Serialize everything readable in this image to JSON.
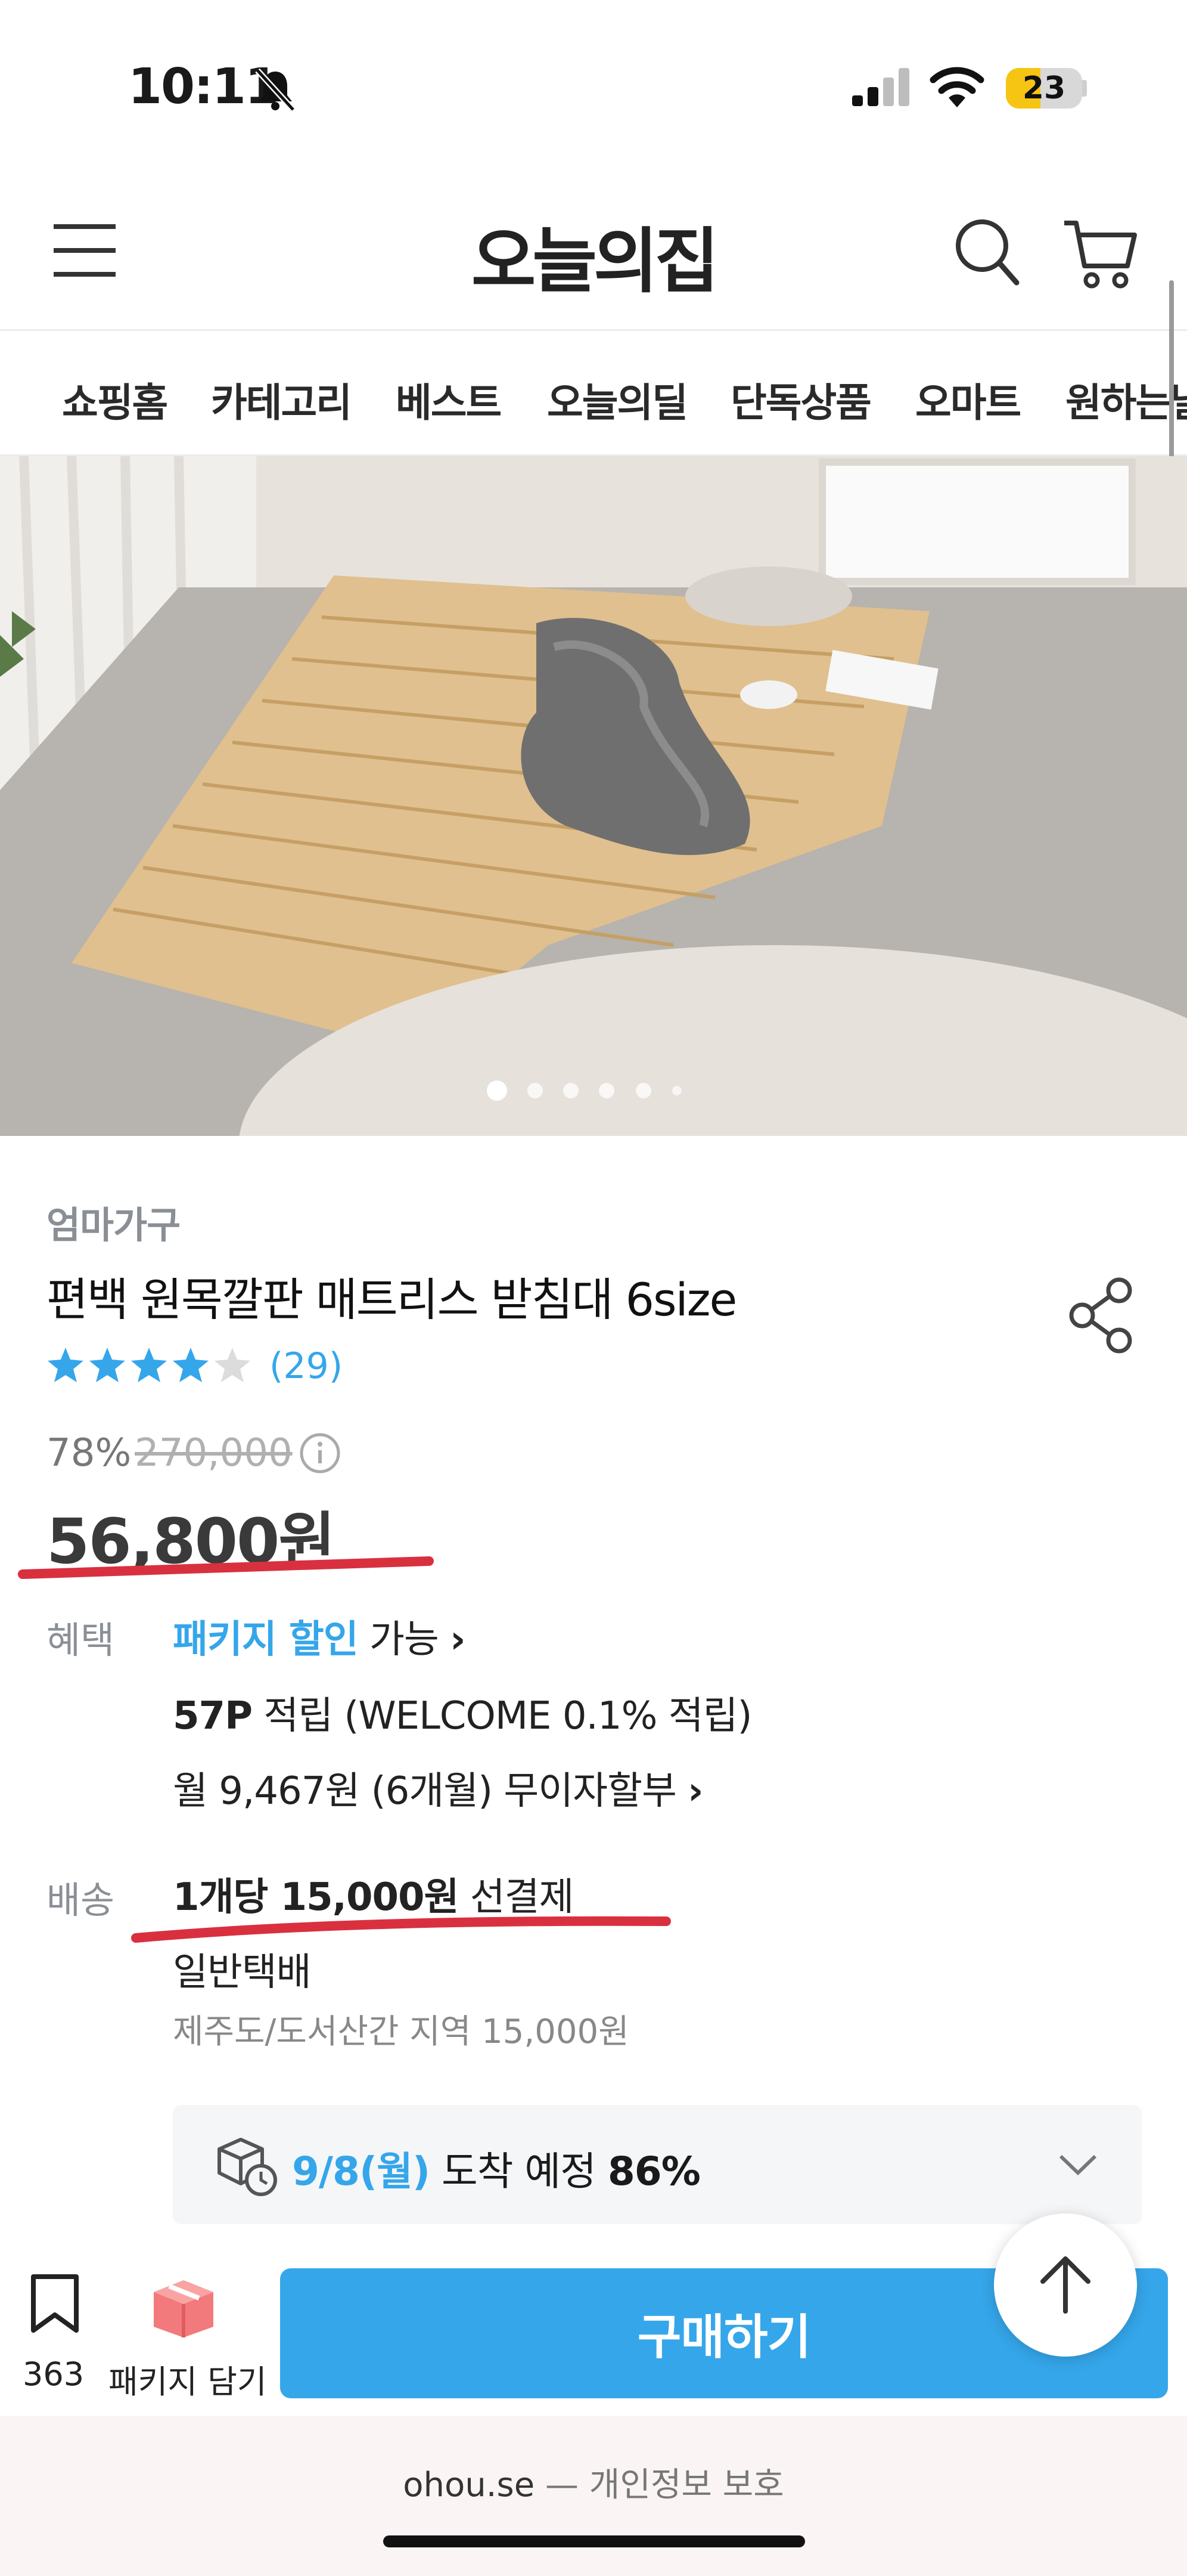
{
  "status_bar": {
    "time": "10:11",
    "battery": "23"
  },
  "header": {
    "logo": "오늘의집"
  },
  "nav": {
    "items": [
      "쇼핑홈",
      "카테고리",
      "베스트",
      "오늘의딜",
      "단독상품",
      "오마트",
      "원하는날"
    ]
  },
  "product": {
    "brand": "엄마가구",
    "title": "편백 원목깔판 매트리스 받침대 6size",
    "rating": 4.5,
    "review_count": "(29)",
    "discount": "78%",
    "original_price": "270,000",
    "price": "56,800원"
  },
  "benefits": {
    "label": "혜택",
    "package_discount": "패키지 할인",
    "package_available": "가능",
    "points_bold": "57P",
    "points_rest": "적립 (WELCOME 0.1% 적립)",
    "installment": "월 9,467원 (6개월) 무이자할부"
  },
  "shipping": {
    "label": "배송",
    "fee_bold": "1개당 15,000원",
    "fee_rest": "선결제",
    "method": "일반택배",
    "extra": "제주도/도서산간 지역 15,000원"
  },
  "arrival": {
    "date": "9/8(월)",
    "text": "도착 예정",
    "percent": "86%"
  },
  "bottom": {
    "save_count": "363",
    "package_label": "패키지 담기",
    "buy_label": "구매하기"
  },
  "footer": {
    "domain": "ohou.se",
    "privacy": "— 개인정보 보호"
  },
  "carousel": {
    "count": 6,
    "active": 0
  },
  "colors": {
    "accent": "#35a6ea",
    "annotation_red": "#d9303f"
  }
}
